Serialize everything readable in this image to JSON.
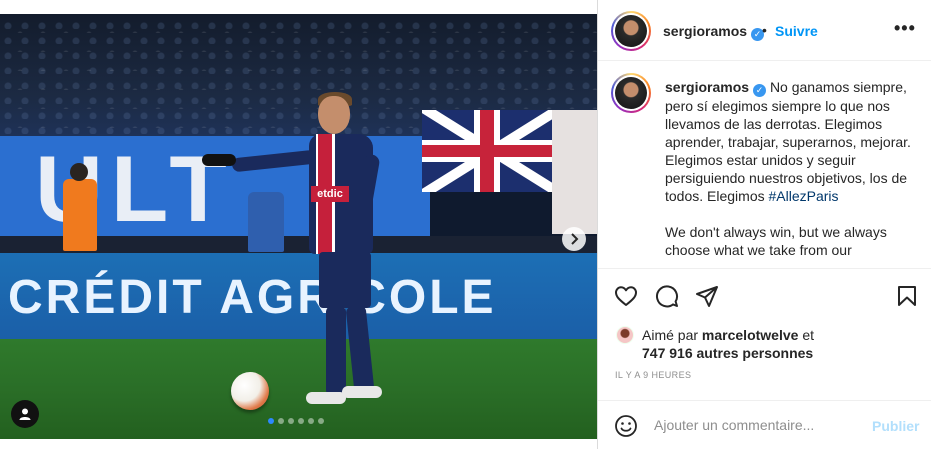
{
  "post": {
    "media": {
      "ad_board_text": "CRÉDIT AGRICOLE",
      "stand_banner_text": "ULT",
      "jersey_sponsor": "etdic",
      "carousel_count": 6,
      "carousel_active_index": 0,
      "next_icon": "chevron-right-icon",
      "tag_icon": "user-tag-icon"
    },
    "header": {
      "username": "sergioramos",
      "verified_symbol": "✓",
      "separator": "•",
      "follow_label": "Suivre",
      "more_label": "•••"
    },
    "caption": {
      "username": "sergioramos",
      "text_es": "No ganamos siempre, pero sí elegimos siempre lo que nos llevamos de las derrotas. Elegimos aprender, trabajar, superarnos, mejorar. Elegimos estar unidos y seguir persiguiendo nuestros objetivos, los de todos. Elegimos",
      "hashtag": "#AllezParis",
      "text_en": "We don't always win, but we always choose what we take from our"
    },
    "actions": {
      "like_icon": "heart-icon",
      "comment_icon": "comment-icon",
      "share_icon": "send-icon",
      "save_icon": "bookmark-icon"
    },
    "likes": {
      "prefix": "Aimé par",
      "liker": "marcelotwelve",
      "connector": "et",
      "others": "747 916 autres personnes"
    },
    "timestamp": "IL Y A 9 HEURES",
    "comment": {
      "emoji_icon": "smiley-icon",
      "placeholder": "Ajouter un commentaire...",
      "publish_label": "Publier"
    }
  },
  "colors": {
    "link_blue": "#0095f6",
    "hashtag_blue": "#00376b",
    "publish_disabled": "#b2dffc",
    "muted": "#8e8e8e"
  }
}
